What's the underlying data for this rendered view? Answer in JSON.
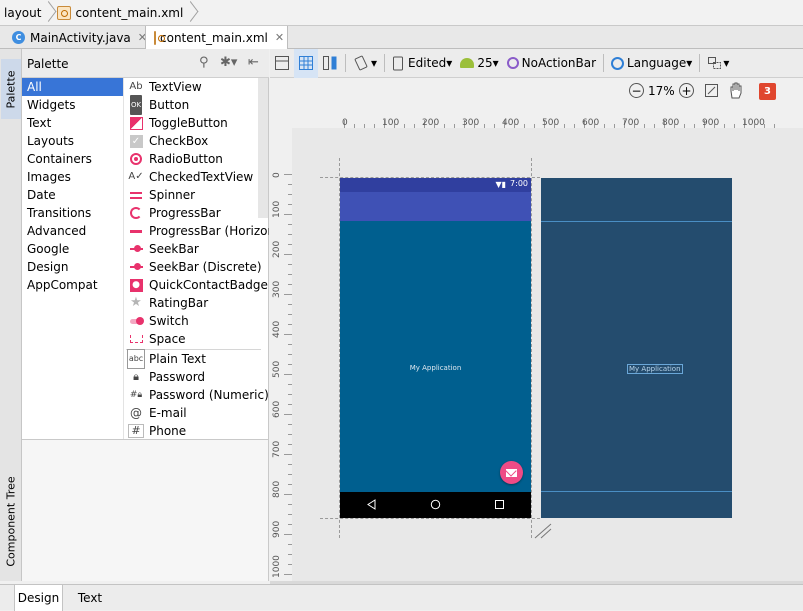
{
  "breadcrumb": {
    "items": [
      "layout",
      "content_main.xml"
    ]
  },
  "editor_tabs": [
    {
      "label": "MainActivity.java",
      "active": false
    },
    {
      "label": "content_main.xml",
      "active": true
    }
  ],
  "side_tabs": {
    "palette": "Palette",
    "component_tree": "Component Tree"
  },
  "palette": {
    "title": "Palette",
    "categories": [
      "All",
      "Widgets",
      "Text",
      "Layouts",
      "Containers",
      "Images",
      "Date",
      "Transitions",
      "Advanced",
      "Google",
      "Design",
      "AppCompat"
    ],
    "selected_category": "All",
    "widgets": [
      {
        "label": "TextView",
        "icon": "ab"
      },
      {
        "label": "Button",
        "icon": "OK"
      },
      {
        "label": "ToggleButton",
        "icon": "toggle"
      },
      {
        "label": "CheckBox",
        "icon": "check"
      },
      {
        "label": "RadioButton",
        "icon": "radio"
      },
      {
        "label": "CheckedTextView",
        "icon": "checked-text"
      },
      {
        "label": "Spinner",
        "icon": "spinner"
      },
      {
        "label": "ProgressBar",
        "icon": "progress"
      },
      {
        "label": "ProgressBar (Horizontal)",
        "icon": "progress-h"
      },
      {
        "label": "SeekBar",
        "icon": "seek"
      },
      {
        "label": "SeekBar (Discrete)",
        "icon": "seek-d"
      },
      {
        "label": "QuickContactBadge",
        "icon": "contact"
      },
      {
        "label": "RatingBar",
        "icon": "star"
      },
      {
        "label": "Switch",
        "icon": "switch"
      },
      {
        "label": "Space",
        "icon": "space"
      },
      {
        "label": "Plain Text",
        "icon": "abc"
      },
      {
        "label": "Password",
        "icon": "lock"
      },
      {
        "label": "Password (Numeric)",
        "icon": "lock-num"
      },
      {
        "label": "E-mail",
        "icon": "at"
      },
      {
        "label": "Phone",
        "icon": "hash"
      }
    ]
  },
  "toolbar": {
    "edited": "Edited",
    "api_level": "25",
    "theme": "NoActionBar",
    "language": "Language"
  },
  "zoom": {
    "level": "17%",
    "warnings": "3"
  },
  "ruler": {
    "x_labels": [
      "0",
      "100",
      "200",
      "300",
      "400",
      "500",
      "600",
      "700",
      "800",
      "900",
      "1000"
    ],
    "y_labels": [
      "0",
      "100",
      "200",
      "300",
      "400",
      "500",
      "600",
      "700",
      "800",
      "900",
      "1000"
    ]
  },
  "device": {
    "status_time": "7:00",
    "app_text": "My Application",
    "colors": {
      "primary": "#3f51b5",
      "primary_dark": "#303f9f",
      "content": "#005f8f",
      "fab": "#ef4b86",
      "blueprint": "#244c6e"
    }
  },
  "bottom_tabs": [
    {
      "label": "Design",
      "active": true
    },
    {
      "label": "Text",
      "active": false
    }
  ]
}
